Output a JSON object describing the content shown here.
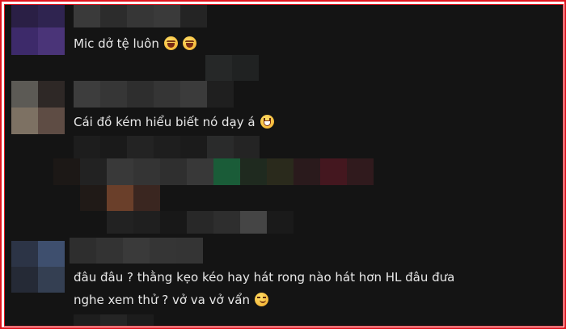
{
  "comments": [
    {
      "text": "Mic dở tệ luôn",
      "emojis": [
        "laughing-tears-emoji",
        "laughing-tears-emoji"
      ]
    },
    {
      "text": "Cái đồ kém hiểu biết nó dạy á",
      "emojis": [
        "grinning-emoji"
      ]
    },
    {
      "line1": "đâu đâu ? thằng kẹo kéo hay hát rong nào hát hơn HL đâu đưa",
      "line2": "nghe xem thử ? vở va vở vẩn",
      "emojis": [
        "smirk-emoji"
      ]
    }
  ],
  "colors": {
    "background": "#141414",
    "text": "#e8e8e8",
    "frame_border": "#e0141e"
  }
}
